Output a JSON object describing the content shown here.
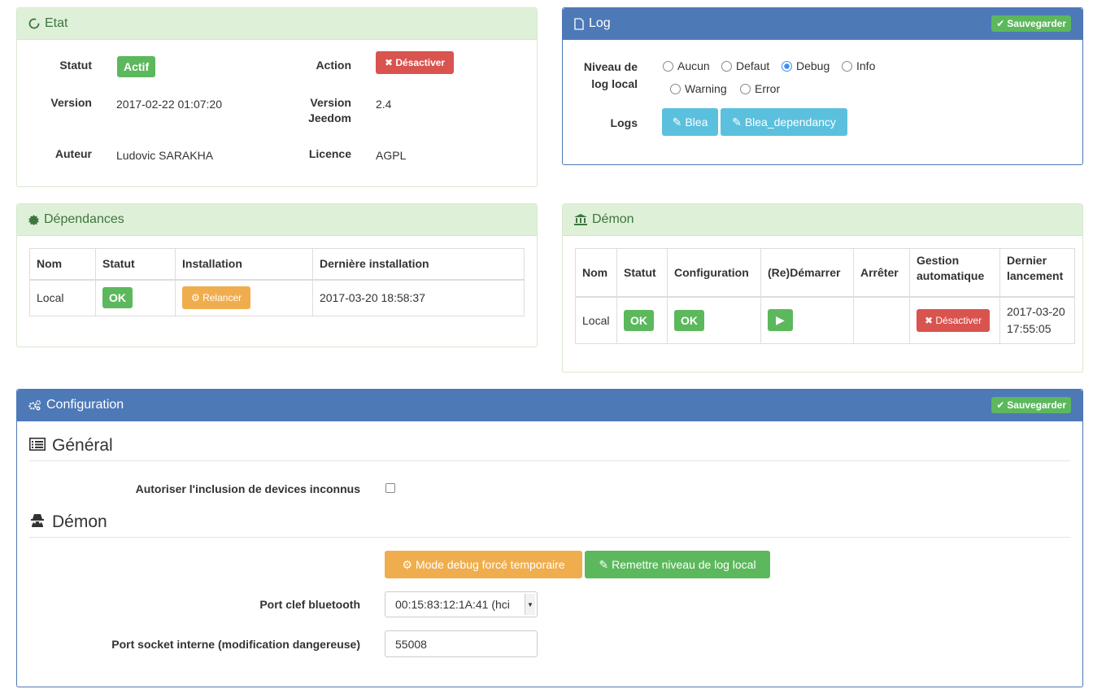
{
  "etat": {
    "title": "Etat",
    "statut_label": "Statut",
    "statut_value": "Actif",
    "action_label": "Action",
    "action_button": "Désactiver",
    "version_label": "Version",
    "version_value": "2017-02-22 01:07:20",
    "version_jeedom_label_1": "Version",
    "version_jeedom_label_2": "Jeedom",
    "version_jeedom_value": "2.4",
    "auteur_label": "Auteur",
    "auteur_value": "Ludovic SARAKHA",
    "licence_label": "Licence",
    "licence_value": "AGPL"
  },
  "log": {
    "title": "Log",
    "save_label": "Sauvegarder",
    "niveau_label_1": "Niveau de",
    "niveau_label_2": "log local",
    "options": [
      "Aucun",
      "Defaut",
      "Debug",
      "Info",
      "Warning",
      "Error"
    ],
    "selected": "Debug",
    "logs_label": "Logs",
    "log_buttons": [
      "Blea",
      "Blea_dependancy"
    ]
  },
  "dependances": {
    "title": "Dépendances",
    "headers": [
      "Nom",
      "Statut",
      "Installation",
      "Dernière installation"
    ],
    "row": {
      "nom": "Local",
      "statut": "OK",
      "installation": "Relancer",
      "derniere": "2017-03-20 18:58:37"
    }
  },
  "demon": {
    "title": "Démon",
    "headers": [
      "Nom",
      "Statut",
      "Configuration",
      "(Re)Démarrer",
      "Arrêter",
      "Gestion",
      "automatique",
      "Dernier",
      "lancement"
    ],
    "row": {
      "nom": "Local",
      "statut": "OK",
      "configuration": "OK",
      "gestion": "Désactiver",
      "dernier_1": "2017-03-20",
      "dernier_2": "17:55:05"
    }
  },
  "configuration": {
    "title": "Configuration",
    "save_label": "Sauvegarder",
    "general_title": "Général",
    "inclusion_label": "Autoriser l'inclusion de devices inconnus",
    "inclusion_checked": false,
    "demon_title": "Démon",
    "debug_button": "Mode debug forcé temporaire",
    "reset_button": "Remettre niveau de log local",
    "port_label": "Port clef bluetooth",
    "port_value": "00:15:83:12:1A:41 (hci",
    "socket_label": "Port socket interne (modification dangereuse)",
    "socket_value": "55008"
  },
  "colors": {
    "green": "#5cb85c",
    "red": "#d9534f",
    "orange": "#f0ad4e",
    "lightblue": "#5bc0de",
    "blue_header": "#4d79b7"
  }
}
